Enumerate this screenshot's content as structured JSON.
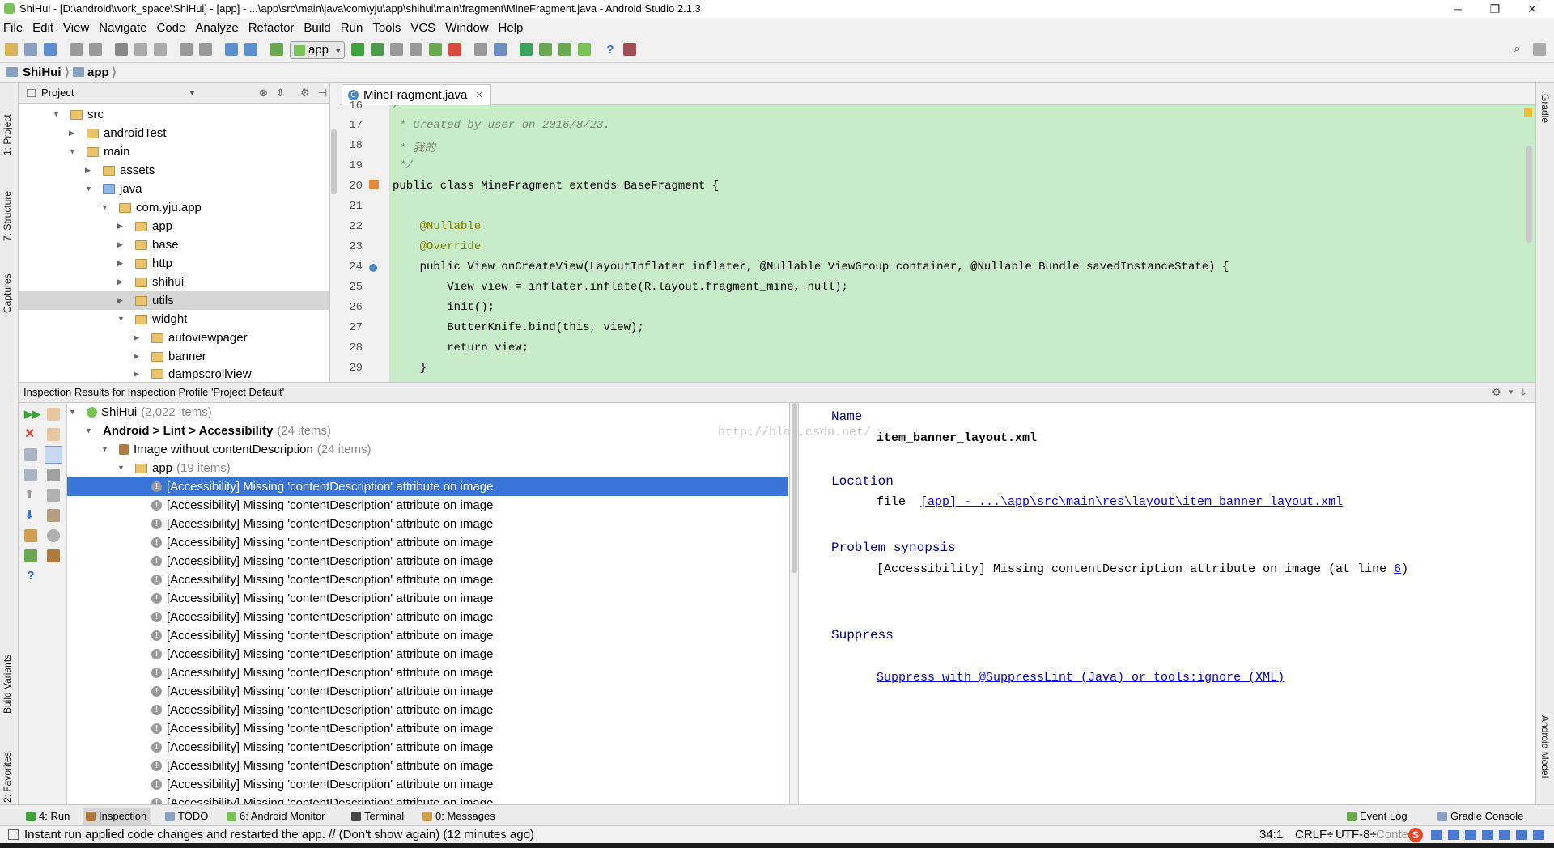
{
  "window": {
    "title": "ShiHui - [D:\\android\\work_space\\ShiHui] - [app] - ...\\app\\src\\main\\java\\com\\yju\\app\\shihui\\main\\fragment\\MineFragment.java - Android Studio 2.1.3",
    "controls": [
      "─",
      "❐",
      "✕"
    ]
  },
  "menu": [
    "File",
    "Edit",
    "View",
    "Navigate",
    "Code",
    "Analyze",
    "Refactor",
    "Build",
    "Run",
    "Tools",
    "VCS",
    "Window",
    "Help"
  ],
  "toolbar": {
    "run_config": "app"
  },
  "breadcrumb": [
    "ShiHui",
    "app"
  ],
  "left_tabs": [
    "1: Project",
    "7: Structure",
    "Captures",
    "Build Variants",
    "2: Favorites"
  ],
  "right_tabs": [
    "Gradle",
    "Android Model"
  ],
  "project": {
    "header": "Project",
    "tree": [
      {
        "label": "src",
        "expanded": true
      },
      {
        "label": "androidTest",
        "expanded": false
      },
      {
        "label": "main",
        "expanded": true
      },
      {
        "label": "assets",
        "expanded": false
      },
      {
        "label": "java",
        "expanded": true
      },
      {
        "label": "com.yju.app",
        "expanded": true
      },
      {
        "label": "app",
        "expanded": false
      },
      {
        "label": "base",
        "expanded": false
      },
      {
        "label": "http",
        "expanded": false
      },
      {
        "label": "shihui",
        "expanded": false
      },
      {
        "label": "utils",
        "expanded": false,
        "selected": true
      },
      {
        "label": "widght",
        "expanded": true
      },
      {
        "label": "autoviewpager",
        "expanded": false
      },
      {
        "label": "banner",
        "expanded": false
      },
      {
        "label": "dampscrollview",
        "expanded": false
      }
    ]
  },
  "editor": {
    "tab": "MineFragment.java",
    "tab_close": "×",
    "line_numbers": [
      "16",
      "17",
      "18",
      "19",
      "20",
      "21",
      "22",
      "23",
      "24",
      "25",
      "26",
      "27",
      "28",
      "29"
    ],
    "lines": [
      "/**",
      " * Created by user on 2016/8/23.",
      " * 我的",
      " */",
      "public class MineFragment extends BaseFragment {",
      "",
      "    @Nullable",
      "    @Override",
      "    public View onCreateView(LayoutInflater inflater, @Nullable ViewGroup container, @Nullable Bundle savedInstanceState) {",
      "        View view = inflater.inflate(R.layout.fragment_mine, null);",
      "        init();",
      "        ButterKnife.bind(this, view);",
      "        return view;",
      "    }"
    ]
  },
  "inspection": {
    "header": "Inspection Results for Inspection Profile 'Project Default'",
    "root": {
      "label": "ShiHui",
      "count": "(2,022 items)"
    },
    "category": {
      "label": "Android > Lint > Accessibility",
      "count": "(24 items)"
    },
    "inspection": {
      "label": "Image without contentDescription",
      "count": "(24 items)"
    },
    "module": {
      "label": "app",
      "count": "(19 items)"
    },
    "items": [
      "[Accessibility] Missing 'contentDescription' attribute on image",
      "[Accessibility] Missing 'contentDescription' attribute on image",
      "[Accessibility] Missing 'contentDescription' attribute on image",
      "[Accessibility] Missing 'contentDescription' attribute on image",
      "[Accessibility] Missing 'contentDescription' attribute on image",
      "[Accessibility] Missing 'contentDescription' attribute on image",
      "[Accessibility] Missing 'contentDescription' attribute on image",
      "[Accessibility] Missing 'contentDescription' attribute on image",
      "[Accessibility] Missing 'contentDescription' attribute on image",
      "[Accessibility] Missing 'contentDescription' attribute on image",
      "[Accessibility] Missing 'contentDescription' attribute on image",
      "[Accessibility] Missing 'contentDescription' attribute on image",
      "[Accessibility] Missing 'contentDescription' attribute on image",
      "[Accessibility] Missing 'contentDescription' attribute on image",
      "[Accessibility] Missing 'contentDescription' attribute on image",
      "[Accessibility] Missing 'contentDescription' attribute on image",
      "[Accessibility] Missing 'contentDescription' attribute on image",
      "[Accessibility] Missing 'contentDescription' attribute on image"
    ],
    "detail": {
      "name_label": "Name",
      "name_value": "item_banner_layout.xml",
      "location_label": "Location",
      "location_prefix": "file",
      "location_link": "[app] - ...\\app\\src\\main\\res\\layout\\item_banner_layout.xml",
      "synopsis_label": "Problem synopsis",
      "synopsis_text": "[Accessibility] Missing contentDescription attribute on image (at line ",
      "synopsis_line": "6",
      "synopsis_end": ")",
      "suppress_label": "Suppress",
      "suppress_link": "Suppress with @SuppressLint (Java) or tools:ignore (XML)",
      "watermark": "http://blog.csdn.net/"
    }
  },
  "tool_windows": {
    "left": [
      "4: Run",
      "Inspection",
      "TODO",
      "6: Android Monitor",
      "Terminal",
      "0: Messages"
    ],
    "right": [
      "Event Log",
      "Gradle Console"
    ]
  },
  "status": {
    "message": "Instant run applied code changes and restarted the app. // (Don't show again) (12 minutes ago)",
    "position": "34:1",
    "line_sep": "CRLF÷",
    "encoding": "UTF-8÷",
    "context": "Conte"
  },
  "colors": {
    "editor_bg": "#c7ecc7",
    "selection": "#3875d7",
    "keyword": "#000080",
    "annotation": "#808000"
  }
}
